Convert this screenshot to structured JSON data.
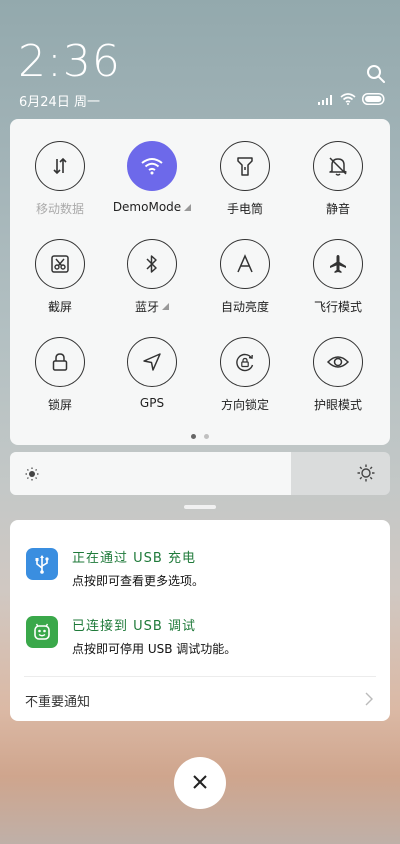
{
  "status": {
    "time": "2:36",
    "date": "6月24日 周一"
  },
  "quick_settings": {
    "tiles": [
      {
        "label": "移动数据",
        "icon": "mobile-data-icon",
        "active": false,
        "dim": true
      },
      {
        "label": "DemoMode",
        "icon": "wifi-icon",
        "active": true,
        "dim": false,
        "more": true
      },
      {
        "label": "手电筒",
        "icon": "flashlight-icon",
        "active": false,
        "dim": false
      },
      {
        "label": "静音",
        "icon": "mute-bell-icon",
        "active": false,
        "dim": false
      },
      {
        "label": "截屏",
        "icon": "screenshot-icon",
        "active": false,
        "dim": false
      },
      {
        "label": "蓝牙",
        "icon": "bluetooth-icon",
        "active": false,
        "dim": false,
        "more": true
      },
      {
        "label": "自动亮度",
        "icon": "auto-brightness-icon",
        "active": false,
        "dim": false
      },
      {
        "label": "飞行模式",
        "icon": "airplane-icon",
        "active": false,
        "dim": false
      },
      {
        "label": "锁屏",
        "icon": "lock-icon",
        "active": false,
        "dim": false
      },
      {
        "label": "GPS",
        "icon": "location-icon",
        "active": false,
        "dim": false
      },
      {
        "label": "方向锁定",
        "icon": "rotation-lock-icon",
        "active": false,
        "dim": false
      },
      {
        "label": "护眼模式",
        "icon": "eye-icon",
        "active": false,
        "dim": false
      }
    ],
    "page_index": 1,
    "page_count": 2
  },
  "brightness": {
    "level": 0.74
  },
  "notifications": {
    "items": [
      {
        "title": "正在通过 USB 充电",
        "subtitle": "点按即可查看更多选项。",
        "icon": "usb-icon",
        "color": "#3a8ee0"
      },
      {
        "title": "已连接到 USB 调试",
        "subtitle": "点按即可停用 USB 调试功能。",
        "icon": "android-debug-icon",
        "color": "#3aa84a"
      }
    ],
    "footer": "不重要通知"
  },
  "colors": {
    "accent": "#6d69ea",
    "notif_title": "#1f7a3a"
  }
}
